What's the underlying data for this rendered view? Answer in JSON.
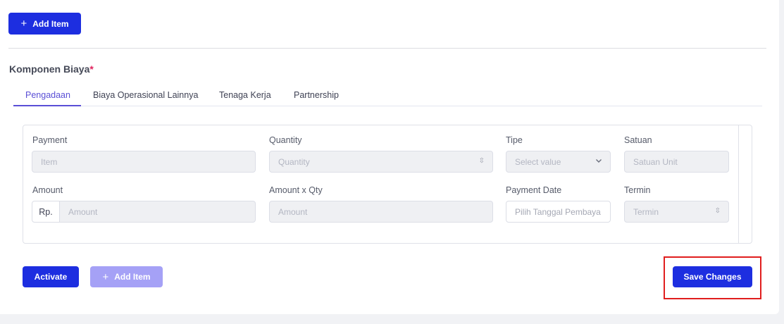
{
  "top_add_button": {
    "icon": "+",
    "label": "Add Item"
  },
  "section": {
    "title": "Komponen Biaya",
    "required_marker": "*"
  },
  "tabs": [
    {
      "label": "Pengadaan",
      "active": true
    },
    {
      "label": "Biaya Operasional Lainnya",
      "active": false
    },
    {
      "label": "Tenaga Kerja",
      "active": false
    },
    {
      "label": "Partnership",
      "active": false
    }
  ],
  "form": {
    "payment": {
      "label": "Payment",
      "placeholder": "Item"
    },
    "quantity": {
      "label": "Quantity",
      "placeholder": "Quantity"
    },
    "tipe": {
      "label": "Tipe",
      "placeholder": "Select value"
    },
    "satuan": {
      "label": "Satuan",
      "placeholder": "Satuan Unit"
    },
    "amount": {
      "label": "Amount",
      "prefix": "Rp.",
      "placeholder": "Amount"
    },
    "amount_qty": {
      "label": "Amount x Qty",
      "placeholder": "Amount"
    },
    "payment_date": {
      "label": "Payment Date",
      "placeholder": "Pilih Tanggal Pembaya"
    },
    "termin": {
      "label": "Termin",
      "placeholder": "Termin"
    }
  },
  "actions": {
    "activate_label": "Activate",
    "add_item_icon": "+",
    "add_item_label": "Add Item",
    "save_label": "Save Changes"
  },
  "colors": {
    "primary": "#1d2ee0",
    "primary_disabled": "#a5a1f6",
    "tab_active": "#5a4fd6",
    "required": "#e0245e",
    "highlight": "#e01e1e"
  }
}
